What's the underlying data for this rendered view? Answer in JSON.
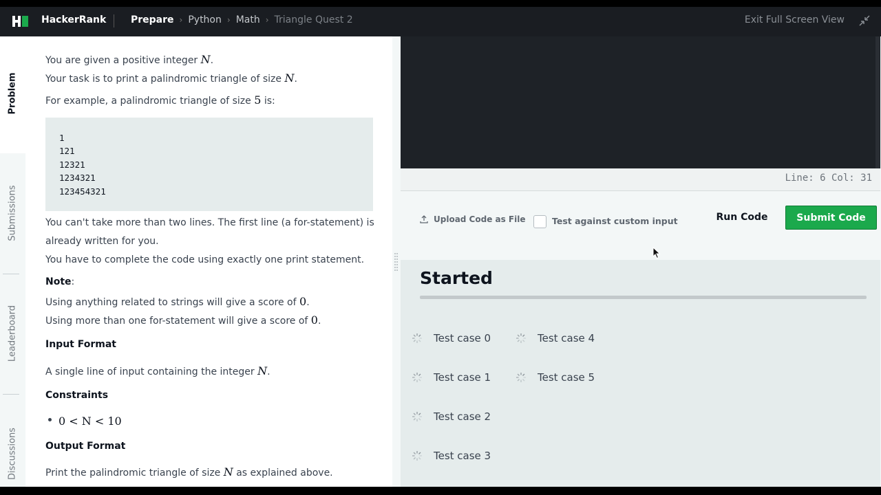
{
  "nav": {
    "brand": "HackerRank",
    "breadcrumbs": [
      "Prepare",
      "Python",
      "Math",
      "Triangle Quest 2"
    ],
    "exit_fullscreen": "Exit Full Screen View"
  },
  "sidebar": {
    "tabs": [
      "Problem",
      "Submissions",
      "Leaderboard",
      "Discussions"
    ],
    "active_tab": "Problem"
  },
  "problem": {
    "intro_1": "You are given a positive integer",
    "var_n": "N",
    "period": ".",
    "intro_2": "Your task is to print a palindromic triangle of size",
    "example_prefix": "For example, a palindromic triangle of size",
    "example_size": "5",
    "example_suffix": "is:",
    "example_rows": [
      "1",
      "121",
      "12321",
      "1234321",
      "123454321"
    ],
    "rule_1": "You can't take more than two lines. The first line (a for-statement) is",
    "rule_2": "already written for you.",
    "rule_3": "You have to complete the code using exactly one print statement.",
    "note_label": "Note",
    "note_colon": ":",
    "note_1": "Using anything related to strings will give a score of",
    "note_2": "Using more than one for-statement will give a score of",
    "zero": "0",
    "input_format_heading": "Input Format",
    "input_format_text": "A single line of input containing the integer",
    "constraints_heading": "Constraints",
    "constraint": "0 < N < 10",
    "output_format_heading": "Output Format",
    "output_prefix": "Print the palindromic triangle of size",
    "output_suffix": "as explained above."
  },
  "editor": {
    "status": "Line: 6 Col: 31"
  },
  "actions": {
    "upload": "Upload Code as File",
    "custom_input": "Test against custom input",
    "run": "Run Code",
    "submit": "Submit Code"
  },
  "results": {
    "status": "Started",
    "test_cases": [
      "Test case 0",
      "Test case 1",
      "Test case 2",
      "Test case 3",
      "Test case 4",
      "Test case 5"
    ]
  },
  "colors": {
    "nav_bg": "#1a1d22",
    "submit_green": "#1ba94c",
    "panel_bg": "#e5ecec"
  }
}
